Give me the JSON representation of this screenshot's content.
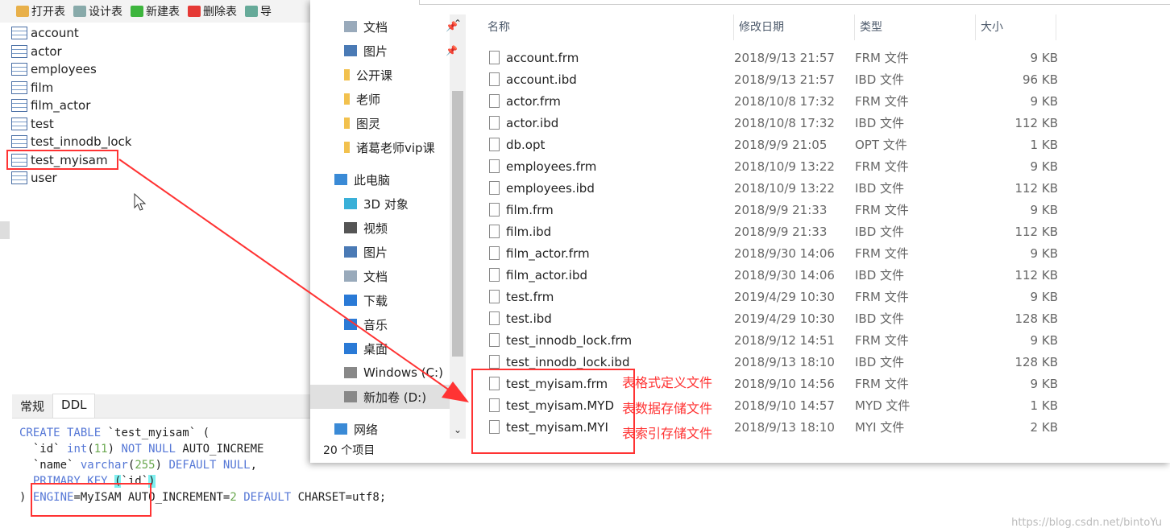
{
  "toolbar": {
    "items": [
      {
        "label": "打开表",
        "color": "#e8b04a"
      },
      {
        "label": "设计表",
        "color": "#8aa"
      },
      {
        "label": "新建表",
        "color": "#3db53d"
      },
      {
        "label": "删除表",
        "color": "#e53935"
      },
      {
        "label": "导",
        "color": "#6a9"
      }
    ]
  },
  "tables": [
    "account",
    "actor",
    "employees",
    "film",
    "film_actor",
    "test",
    "test_innodb_lock",
    "test_myisam",
    "user"
  ],
  "tabs": [
    "常规",
    "DDL"
  ],
  "ddl": {
    "l1a": "CREATE TABLE",
    "l1b": " `test_myisam` (",
    "l2a": "  `id` ",
    "l2b": "int",
    "l2c": "(",
    "l2d": "11",
    "l2e": ") ",
    "l2f": "NOT NULL",
    "l2g": " AUTO_INCREME",
    "l3a": "  `name` ",
    "l3b": "varchar",
    "l3c": "(",
    "l3d": "255",
    "l3e": ") ",
    "l3f": "DEFAULT NULL",
    "l3g": ",",
    "l4a": "  PRIMARY KEY ",
    "l4b": "(",
    "l4c": "`id`",
    "l4d": ")",
    "l5a": ") ",
    "l5b": "ENGINE",
    "l5c": "=MyISAM AUTO_INCREMENT=",
    "l5d": "2",
    "l5e": " ",
    "l5f": "DEFAULT",
    "l5g": " CHARSET=utf8;"
  },
  "nav": [
    {
      "label": "文档",
      "pinned": true,
      "icon": "document-icon"
    },
    {
      "label": "图片",
      "pinned": true,
      "icon": "picture-icon"
    },
    {
      "label": "公开课",
      "icon": "folder-icon"
    },
    {
      "label": "老师",
      "icon": "folder-icon"
    },
    {
      "label": "图灵",
      "icon": "folder-icon"
    },
    {
      "label": "诸葛老师vip课",
      "icon": "folder-icon"
    },
    {
      "label": "此电脑",
      "icon": "computer-icon",
      "top": true
    },
    {
      "label": "3D 对象",
      "icon": "cube-icon"
    },
    {
      "label": "视频",
      "icon": "video-icon"
    },
    {
      "label": "图片",
      "icon": "picture-icon"
    },
    {
      "label": "文档",
      "icon": "document-icon"
    },
    {
      "label": "下载",
      "icon": "download-icon"
    },
    {
      "label": "音乐",
      "icon": "music-icon"
    },
    {
      "label": "桌面",
      "icon": "desktop-icon"
    },
    {
      "label": "Windows (C:)",
      "icon": "drive-icon"
    },
    {
      "label": "新加卷 (D:)",
      "icon": "drive-icon",
      "selected": true
    },
    {
      "label": "网络",
      "icon": "network-icon",
      "top": true
    }
  ],
  "status": "20 个项目",
  "columns": [
    "名称",
    "修改日期",
    "类型",
    "大小"
  ],
  "files": [
    [
      "account.frm",
      "2018/9/13 21:57",
      "FRM 文件",
      "9 KB"
    ],
    [
      "account.ibd",
      "2018/9/13 21:57",
      "IBD 文件",
      "96 KB"
    ],
    [
      "actor.frm",
      "2018/10/8 17:32",
      "FRM 文件",
      "9 KB"
    ],
    [
      "actor.ibd",
      "2018/10/8 17:32",
      "IBD 文件",
      "112 KB"
    ],
    [
      "db.opt",
      "2018/9/9 21:05",
      "OPT 文件",
      "1 KB"
    ],
    [
      "employees.frm",
      "2018/10/9 13:22",
      "FRM 文件",
      "9 KB"
    ],
    [
      "employees.ibd",
      "2018/10/9 13:22",
      "IBD 文件",
      "112 KB"
    ],
    [
      "film.frm",
      "2018/9/9 21:33",
      "FRM 文件",
      "9 KB"
    ],
    [
      "film.ibd",
      "2018/9/9 21:33",
      "IBD 文件",
      "112 KB"
    ],
    [
      "film_actor.frm",
      "2018/9/30 14:06",
      "FRM 文件",
      "9 KB"
    ],
    [
      "film_actor.ibd",
      "2018/9/30 14:06",
      "IBD 文件",
      "112 KB"
    ],
    [
      "test.frm",
      "2019/4/29 10:30",
      "FRM 文件",
      "9 KB"
    ],
    [
      "test.ibd",
      "2019/4/29 10:30",
      "IBD 文件",
      "128 KB"
    ],
    [
      "test_innodb_lock.frm",
      "2018/9/12 14:51",
      "FRM 文件",
      "9 KB"
    ],
    [
      "test_innodb_lock.ibd",
      "2018/9/13 18:10",
      "IBD 文件",
      "128 KB"
    ],
    [
      "test_myisam.frm",
      "2018/9/10 14:56",
      "FRM 文件",
      "9 KB"
    ],
    [
      "test_myisam.MYD",
      "2018/9/10 14:57",
      "MYD 文件",
      "1 KB"
    ],
    [
      "test_myisam.MYI",
      "2018/9/13 18:10",
      "MYI 文件",
      "2 KB"
    ]
  ],
  "notes": [
    "表格式定义文件",
    "表数据存储文件",
    "表索引存储文件"
  ],
  "watermark": "https://blog.csdn.net/bintoYu",
  "accent": "#ff3333"
}
